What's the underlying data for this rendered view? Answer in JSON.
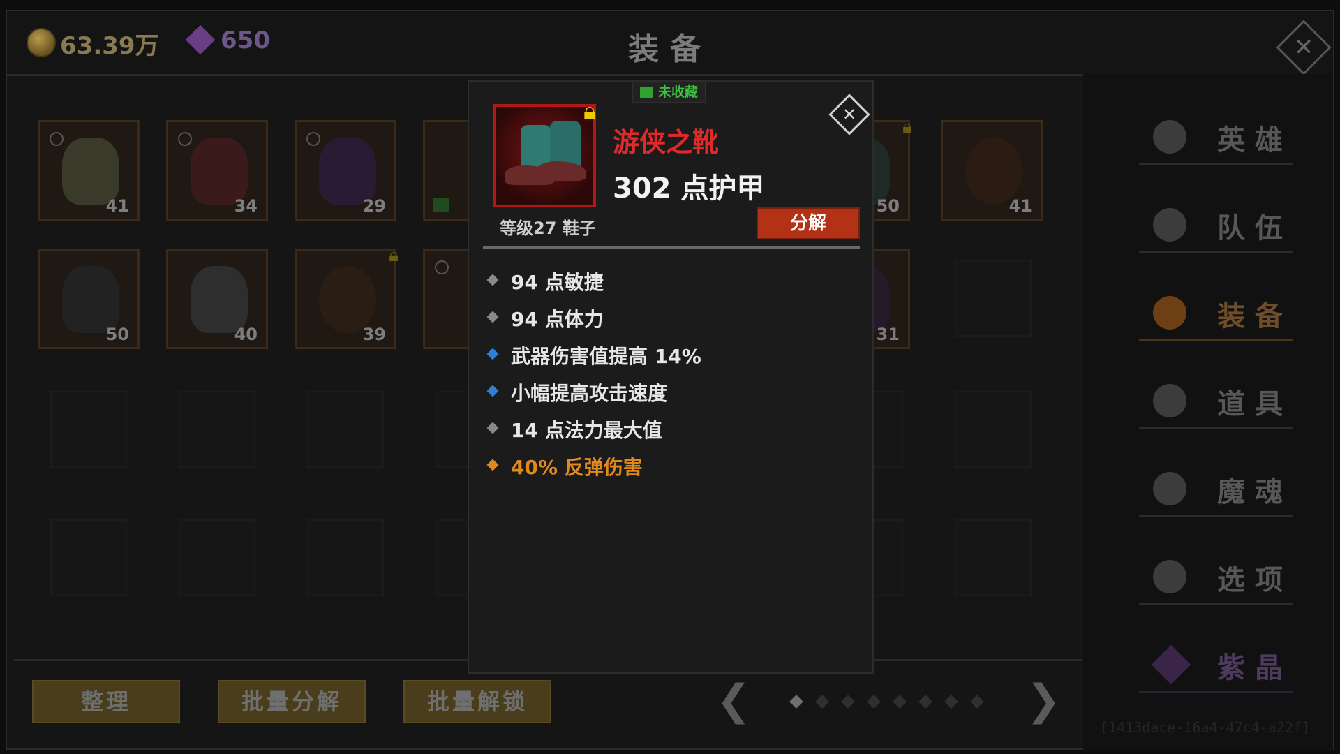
{
  "header": {
    "gold": "63.39万",
    "gems": "650",
    "title": "装备"
  },
  "inventory": {
    "row1": [
      "41",
      "34",
      "29",
      "",
      "",
      "",
      "50",
      "41"
    ],
    "row2": [
      "50",
      "40",
      "39",
      "",
      "",
      "",
      "31",
      ""
    ]
  },
  "bottom": {
    "buttons": [
      "整理",
      "批量分解",
      "批量解锁"
    ],
    "page_count": 8,
    "active_page": 1
  },
  "side_menu": {
    "items": [
      "英雄",
      "队伍",
      "装备",
      "道具",
      "魔魂",
      "选项",
      "紫晶"
    ],
    "active": "装备",
    "faint_id": "[1413dace-16a4-47c4-a22f]"
  },
  "popup": {
    "collect_status": "未收藏",
    "item_name": "游侠之靴",
    "armor": "302 点护甲",
    "level_type": "等级27 鞋子",
    "decompose_label": "分解",
    "stats": [
      {
        "text": "94 点敏捷",
        "color": "#e6e6e6",
        "diamond": "#8a8a8a"
      },
      {
        "text": "94 点体力",
        "color": "#e6e6e6",
        "diamond": "#8a8a8a"
      },
      {
        "text": "武器伤害值提高 14%",
        "color": "#e6e6e6",
        "diamond": "#2f7fd6"
      },
      {
        "text": "小幅提高攻击速度",
        "color": "#e6e6e6",
        "diamond": "#2f7fd6"
      },
      {
        "text": "14 点法力最大值",
        "color": "#e6e6e6",
        "diamond": "#8a8a8a"
      },
      {
        "text": "40% 反弹伤害",
        "color": "#e08a1e",
        "diamond": "#e08a1e"
      }
    ]
  },
  "colors": {
    "name_red": "#e02a2a",
    "decompose_red": "#b33216",
    "collect_green": "#3fbf3f",
    "lock_yellow": "#f0c800"
  }
}
